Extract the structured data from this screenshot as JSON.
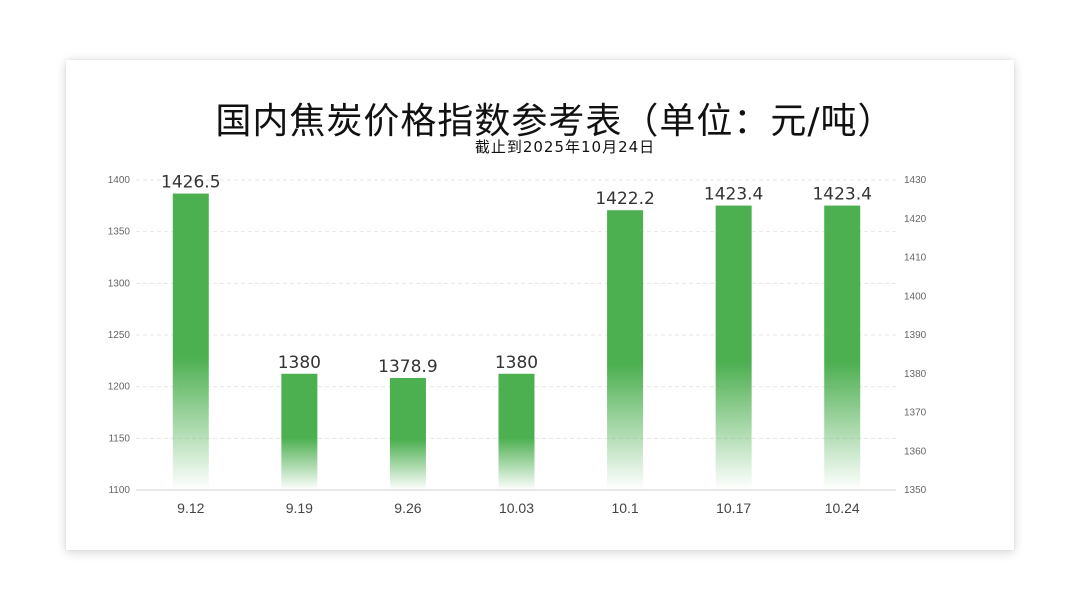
{
  "title": "国内焦炭价格指数参考表（单位：元/吨）",
  "subtitle": "截止到2025年10月24日",
  "colors": {
    "bar": "#4caf50",
    "grid": "#e6e6e6",
    "axis": "#d0d0d0"
  },
  "chart_data": {
    "type": "bar",
    "title": "国内焦炭价格指数参考表（单位：元/吨）",
    "subtitle": "截止到2025年10月24日",
    "categories": [
      "9.12",
      "9.19",
      "9.26",
      "10.03",
      "10.1",
      "10.17",
      "10.24"
    ],
    "values": [
      1426.5,
      1380,
      1378.9,
      1380,
      1422.2,
      1423.4,
      1423.4
    ],
    "value_labels": [
      "1426.5",
      "1380",
      "1378.9",
      "1380",
      "1422.2",
      "1423.4",
      "1423.4"
    ],
    "ylim_left": [
      1100,
      1400
    ],
    "yticks_left": [
      "1100",
      "1150",
      "1200",
      "1250",
      "1300",
      "1350",
      "1400"
    ],
    "ylim_right": [
      1350,
      1430
    ],
    "yticks_right": [
      "1350",
      "1360",
      "1370",
      "1380",
      "1390",
      "1400",
      "1410",
      "1420",
      "1430"
    ],
    "bars_plotted_on": "right",
    "grid": true,
    "legend": "none"
  }
}
